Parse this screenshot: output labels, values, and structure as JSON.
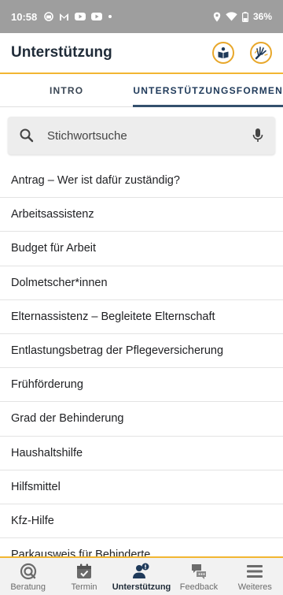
{
  "status_bar": {
    "time": "10:58",
    "battery": "36%"
  },
  "app_bar": {
    "title": "Unterstützung"
  },
  "tabs": [
    {
      "label": "INTRO",
      "active": false
    },
    {
      "label": "UNTERSTÜTZUNGSFORMEN",
      "active": true
    }
  ],
  "search": {
    "placeholder": "Stichwortsuche"
  },
  "topics": [
    "Antrag – Wer ist dafür zuständig?",
    "Arbeitsassistenz",
    "Budget für Arbeit",
    "Dolmetscher*innen",
    "Elternassistenz – Begleitete Elternschaft",
    "Entlastungsbetrag der Pflegeversicherung",
    "Frühförderung",
    "Grad der Behinderung",
    "Haushaltshilfe",
    "Hilfsmittel",
    "Kfz-Hilfe",
    "Parkausweis für Behinderte"
  ],
  "bottom_nav": [
    {
      "label": "Beratung",
      "icon": "beratung-icon"
    },
    {
      "label": "Termin",
      "icon": "calendar-icon"
    },
    {
      "label": "Unterstützung",
      "icon": "people-icon",
      "active": true
    },
    {
      "label": "Feedback",
      "icon": "feedback-icon"
    },
    {
      "label": "Weiteres",
      "icon": "menu-icon"
    }
  ],
  "colors": {
    "accent": "#f2b632",
    "primary": "#1f3a5a",
    "status_bar": "#9e9e9e"
  }
}
